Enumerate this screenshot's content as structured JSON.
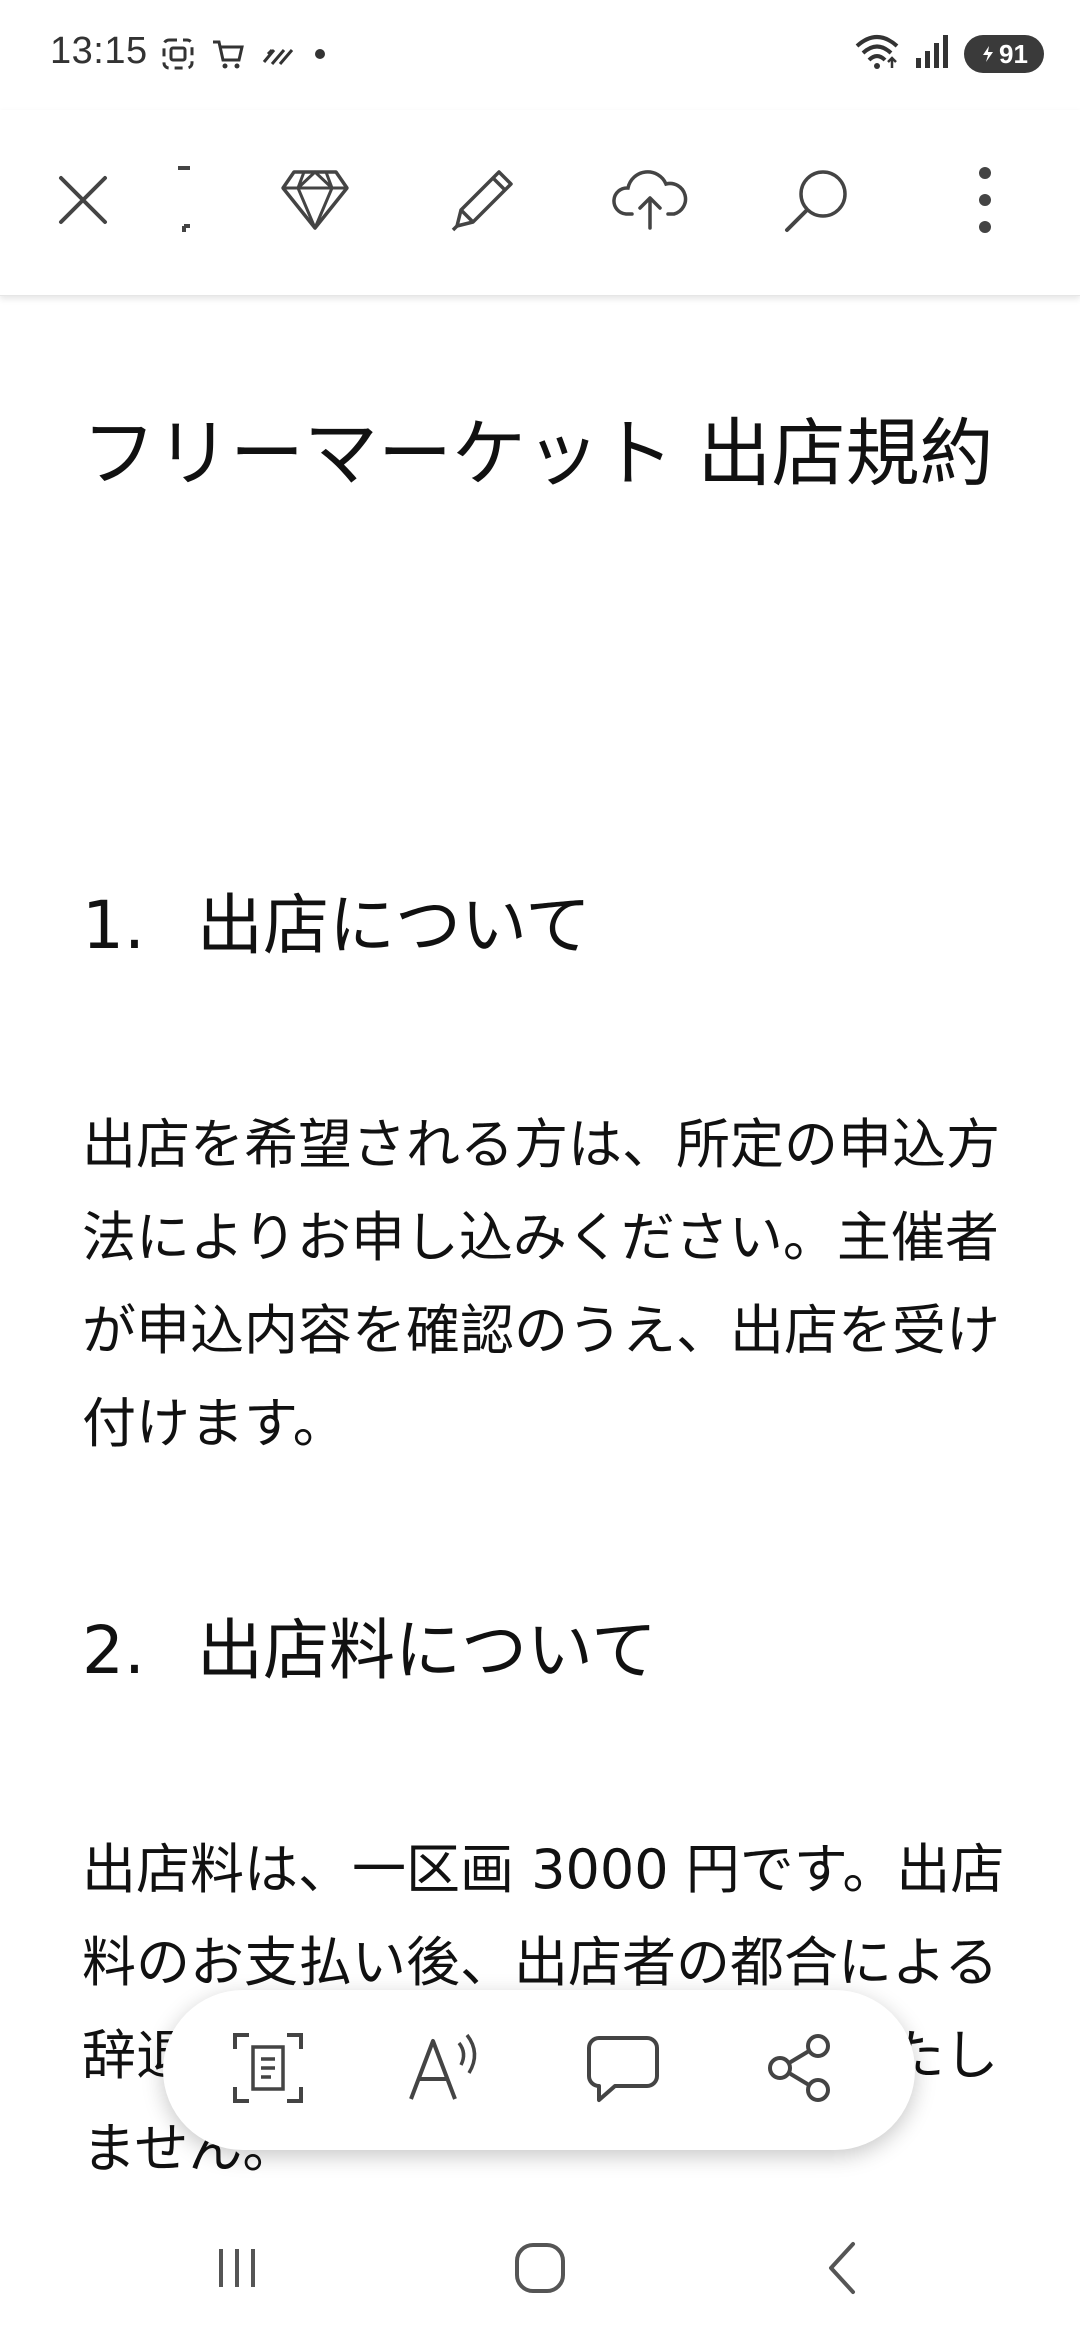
{
  "status_bar": {
    "time": "13:15",
    "battery": "91",
    "left_icons": [
      "screenshot-icon",
      "cart-icon",
      "signal-pattern-icon",
      "dot-icon"
    ],
    "right_icons": [
      "wifi-icon",
      "cellular-signal-icon",
      "battery-icon"
    ]
  },
  "toolbar": {
    "icons": [
      "close-icon",
      "divider-icon",
      "diamond-icon",
      "pencil-icon",
      "cloud-upload-icon",
      "search-icon",
      "more-vertical-icon"
    ]
  },
  "document": {
    "title": "フリーマーケット 出店規約",
    "sections": [
      {
        "number": "1.",
        "heading": "出店について",
        "body": "出店を希望される方は、所定の申込方法によりお申し込みください。主催者が申込内容を確認のうえ、出店を受け付けます。"
      },
      {
        "number": "2.",
        "heading": "出店料について",
        "body": "出店料は、一区画 3000 円です。出店料のお支払い後、出店者の都合による辞退の場合は、原則として返金いたしません。"
      }
    ]
  },
  "floating_bar": {
    "icons": [
      "scan-text-icon",
      "read-aloud-icon",
      "comment-icon",
      "share-icon"
    ]
  },
  "nav_bar": {
    "icons": [
      "recent-apps-icon",
      "home-icon",
      "back-icon"
    ]
  }
}
